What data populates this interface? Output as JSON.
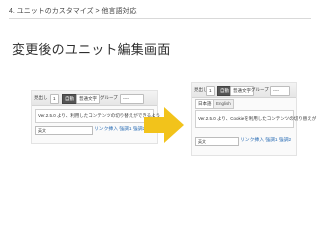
{
  "header": {
    "text": "4. ユニットのカスタマイズ > 他言語対応"
  },
  "title": "変更後のユニット編集画面",
  "colors": {
    "arrow": "#f2c31b",
    "link": "#2a6db5"
  },
  "left_panel": {
    "toolbar": {
      "label": "見出し",
      "num": "1",
      "mode": "自動",
      "size": "普通文字",
      "group_label": "グループ",
      "group_value": "----"
    },
    "editor_text": "Ver.2.5.0 より、利用したコンテンツの切り替えができるよう",
    "bottom_select": "英文",
    "bottom_links": "リンク挿入 強調1 強調2"
  },
  "right_panel": {
    "toolbar": {
      "label": "見出し",
      "num": "1",
      "mode": "自動",
      "size": "普通文字",
      "group_label": "グループ",
      "group_value": "----"
    },
    "tabs": [
      "日本語",
      "English"
    ],
    "editor_text": "Ver.2.5.0 より、Cookieを利用したコンテンツの切り替えが",
    "bottom_select": "英文",
    "bottom_links": "リンク挿入 強調1 強調2"
  }
}
